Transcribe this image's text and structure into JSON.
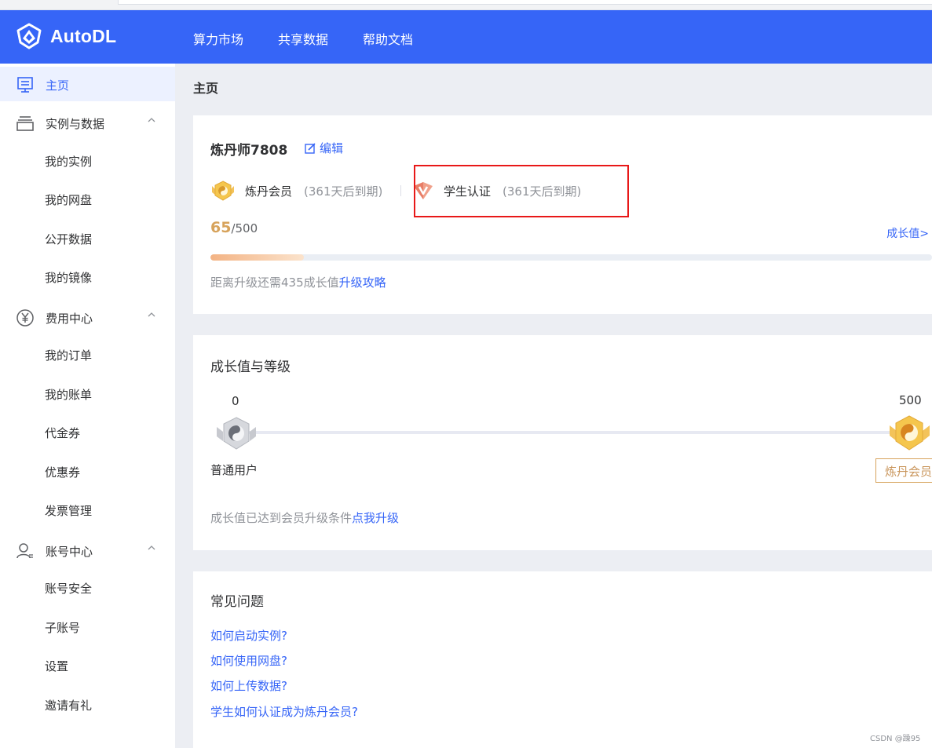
{
  "header": {
    "logo_text": "AutoDL",
    "nav": [
      "算力市场",
      "共享数据",
      "帮助文档"
    ]
  },
  "sidebar": {
    "home": "主页",
    "groups": [
      {
        "label": "实例与数据",
        "icon": "stack-icon",
        "items": [
          "我的实例",
          "我的网盘",
          "公开数据",
          "我的镜像"
        ]
      },
      {
        "label": "费用中心",
        "icon": "yen-icon",
        "items": [
          "我的订单",
          "我的账单",
          "代金券",
          "优惠券",
          "发票管理"
        ]
      },
      {
        "label": "账号中心",
        "icon": "user-icon",
        "items": [
          "账号安全",
          "子账号",
          "设置",
          "邀请有礼"
        ]
      }
    ]
  },
  "breadcrumb": "主页",
  "profile": {
    "username": "炼丹师7808",
    "edit_label": "编辑",
    "badge1_label": "炼丹会员",
    "badge1_expiry": "(361天后到期)",
    "badge2_label": "学生认证",
    "badge2_expiry": "(361天后到期)",
    "score_current": "65",
    "score_total": "/500",
    "progress": 0.13,
    "growth_link": "成长值>",
    "hint_prefix": "距离升级还需435成长值",
    "hint_link": "升级攻略"
  },
  "levels": {
    "title": "成长值与等级",
    "left_value": "0",
    "right_value": "500",
    "left_label": "普通用户",
    "right_label": "炼丹会员",
    "hint_prefix": "成长值已达到会员升级条件",
    "hint_link": "点我升级"
  },
  "faq": {
    "title": "常见问题",
    "items": [
      "如何启动实例?",
      "如何使用网盘?",
      "如何上传数据?",
      "学生如何认证成为炼丹会员?"
    ]
  },
  "watermark": "CSDN @躁95",
  "colors": {
    "primary": "#3665f7",
    "gold": "#d7a35c",
    "annotation": "#e81818"
  }
}
